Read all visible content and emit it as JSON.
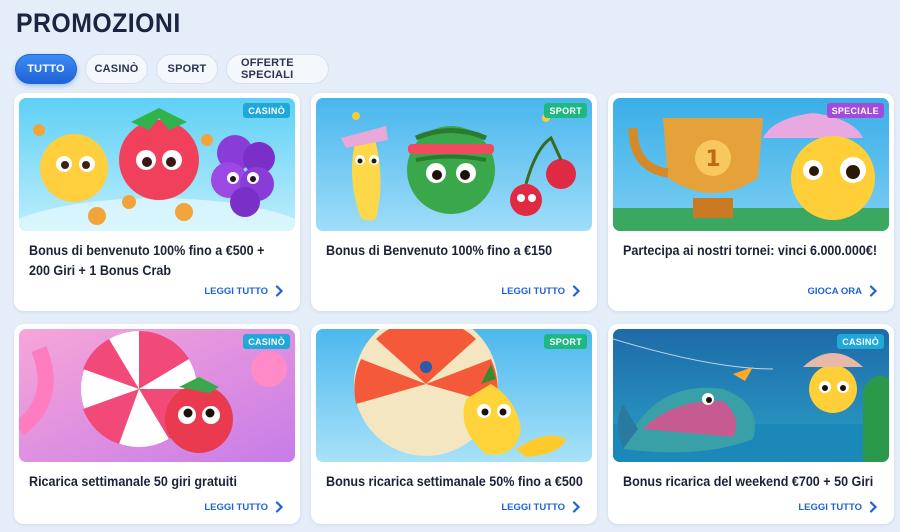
{
  "page": {
    "title": "PROMOZIONI"
  },
  "tabs": [
    {
      "label": "TUTTO",
      "active": true
    },
    {
      "label": "CASINÒ",
      "active": false
    },
    {
      "label": "SPORT",
      "active": false
    },
    {
      "label": "OFFERTE SPECIALI",
      "active": false
    }
  ],
  "badge_colors": {
    "casino": "#1fa8d8",
    "sport": "#1fb882",
    "speciale": "#a24ad9"
  },
  "accent": "#1f63d8",
  "cards": [
    {
      "badge": "CASINÒ",
      "title": "Bonus di benvenuto 100% fino a €500 +",
      "title2": "200 Giri + 1 Bonus Crab",
      "link": "LEGGI TUTTO"
    },
    {
      "badge": "SPORT",
      "title": "Bonus di Benvenuto 100% fino a €150",
      "title2": "",
      "link": "LEGGI TUTTO"
    },
    {
      "badge": "SPECIALE",
      "title": "Partecipa ai nostri tornei: vinci 6.000.000€!",
      "title2": "",
      "link": "GIOCA ORA"
    },
    {
      "badge": "CASINÒ",
      "title": "Ricarica settimanale 50 giri gratuiti",
      "title2": "",
      "link": "LEGGI TUTTO"
    },
    {
      "badge": "SPORT",
      "title": "Bonus ricarica settimanale 50% fino a €500",
      "title2": "",
      "link": "LEGGI TUTTO"
    },
    {
      "badge": "CASINÒ",
      "title": "Bonus ricarica del weekend €700 + 50 Giri",
      "title2": "",
      "link": "LEGGI TUTTO"
    }
  ]
}
